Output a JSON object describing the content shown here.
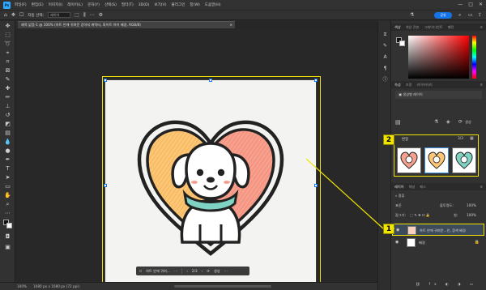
{
  "app": {
    "logo": "Ps",
    "menu": [
      "파일(F)",
      "편집(E)",
      "이미지(I)",
      "레이어(L)",
      "문자(Y)",
      "선택(S)",
      "필터(T)",
      "3D(D)",
      "보기(V)",
      "플러그인",
      "창(W)",
      "도움말(H)"
    ],
    "window_controls": [
      "—",
      "□",
      "✕"
    ]
  },
  "options_bar": {
    "auto_select_label": "자동 선택:",
    "auto_select_value": "레이어",
    "share_label": "공유"
  },
  "document_tab": {
    "title": "제목 없음-1 @ 100% (하트 안에 귀여운 강아지 캐릭터, 화이트 아이 배경, RGB/8)",
    "close": "×"
  },
  "taskbar": {
    "prompt_label": "하트 안에 귀여…",
    "counter": "2/3",
    "generate_label": "생성"
  },
  "status": {
    "zoom": "100%",
    "doc_info": "1080 px x 1080 px (72 ppi)"
  },
  "panels": {
    "color_tabs": [
      "색상",
      "색상 견본",
      "그레이디언트",
      "패턴"
    ],
    "props_tabs": [
      "속성",
      "조정",
      "라이브러리"
    ],
    "props_title": "생성형 레이어",
    "generate_label": "생성",
    "variations_label": "변형",
    "variations_count": "3/3",
    "layers_tabs": [
      "레이어",
      "채널",
      "패스"
    ],
    "kind_label": "종류",
    "blend_mode": "표준",
    "opacity_label": "불투명도:",
    "opacity_value": "100%",
    "lock_label": "잠그기:",
    "fill_label": "칠:",
    "fill_value": "100%",
    "layers": [
      {
        "name": "하트 안에 귀여운...인, 흰색 배경",
        "selected": true
      },
      {
        "name": "배경",
        "selected": false
      }
    ]
  },
  "callouts": {
    "one": "1",
    "two": "2"
  },
  "colors": {
    "accent_highlight": "#f1e400",
    "share_button": "#1473e6",
    "heart_left": "#fbc675",
    "heart_right": "#f7a08e",
    "scarf": "#7fd3c2"
  }
}
